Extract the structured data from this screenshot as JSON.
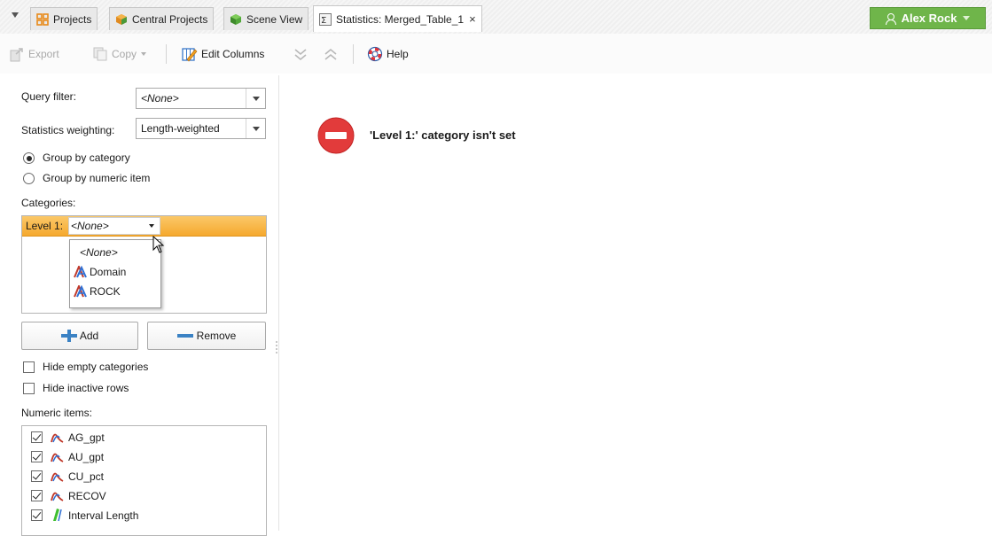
{
  "tabs": [
    {
      "label": "Projects",
      "icon": "projects-grid-icon"
    },
    {
      "label": "Central Projects",
      "icon": "central-projects-icon"
    },
    {
      "label": "Scene View",
      "icon": "scene-cube-icon"
    },
    {
      "label": "Statistics: Merged_Table_1",
      "icon": "statistics-sigma-icon",
      "close": "×"
    }
  ],
  "user": {
    "name": "Alex Rock",
    "color": "#6fb54a"
  },
  "toolbar": {
    "export_label": "Export",
    "copy_label": "Copy",
    "edit_columns_label": "Edit Columns",
    "help_label": "Help"
  },
  "panel": {
    "query_filter_label": "Query filter:",
    "query_filter_value": "<None>",
    "weighting_label": "Statistics weighting:",
    "weighting_value": "Length-weighted",
    "group_by_category": "Group by category",
    "group_by_numeric": "Group by numeric item",
    "categories_label": "Categories:",
    "level_label": "Level 1:",
    "level_value": "<None>",
    "dropdown_options": [
      "<None>",
      "Domain",
      "ROCK"
    ],
    "add_label": "Add",
    "remove_label": "Remove",
    "hide_empty": "Hide empty categories",
    "hide_inactive": "Hide inactive rows",
    "numeric_items_label": "Numeric items:",
    "numeric_items": [
      {
        "name": "AG_gpt",
        "checked": true
      },
      {
        "name": "AU_gpt",
        "checked": true
      },
      {
        "name": "CU_pct",
        "checked": true
      },
      {
        "name": "RECOV",
        "checked": true
      },
      {
        "name": "Interval Length",
        "checked": true
      }
    ]
  },
  "message": {
    "text": "'Level 1:' category isn't set",
    "icon": "error-no-entry-icon",
    "color": "#e23b3b"
  }
}
